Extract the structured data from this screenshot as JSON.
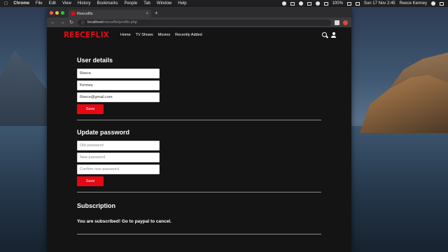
{
  "menubar": {
    "app": "Chrome",
    "items": [
      "File",
      "Edit",
      "View",
      "History",
      "Bookmarks",
      "People",
      "Tab",
      "Window",
      "Help"
    ],
    "battery": "100%",
    "datetime": "Sun 17 Nov  2:45",
    "user": "Reece Kenney"
  },
  "browser": {
    "tab_title": "Reeceflix",
    "new_tab": "+",
    "url_host": "localhost",
    "url_path": "/reeceflix/profile.php"
  },
  "site": {
    "logo": "REECEFLIX",
    "nav": [
      "Home",
      "TV Shows",
      "Movies",
      "Recently Added"
    ]
  },
  "user_details": {
    "title": "User details",
    "first_name": "Reece",
    "last_name": "Kenney",
    "email": "Reece@gmail.com",
    "save_label": "Save"
  },
  "update_password": {
    "title": "Update password",
    "old_placeholder": "Old password",
    "new_placeholder": "New password",
    "confirm_placeholder": "Confirm new password",
    "save_label": "Save"
  },
  "subscription": {
    "title": "Subscription",
    "message": "You are subscribed! Go to paypal to cancel."
  },
  "colors": {
    "brand": "#e50914",
    "background": "#141414"
  }
}
